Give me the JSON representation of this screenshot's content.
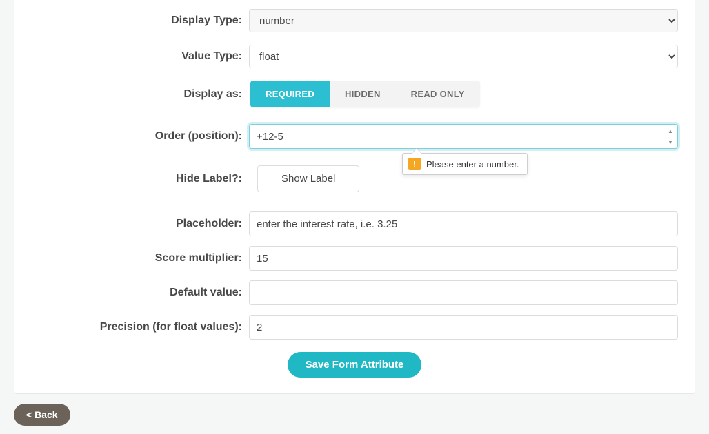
{
  "labels": {
    "display_type": "Display Type:",
    "value_type": "Value Type:",
    "display_as": "Display as:",
    "order": "Order (position):",
    "hide_label": "Hide Label?:",
    "placeholder": "Placeholder:",
    "score_multiplier": "Score multiplier:",
    "default_value": "Default value:",
    "precision": "Precision (for float values):"
  },
  "fields": {
    "display_type": "number",
    "value_type": "float",
    "order": "+12-5",
    "hide_label_button": "Show Label",
    "placeholder": "enter the interest rate, i.e. 3.25",
    "score_multiplier": "15",
    "default_value": "",
    "precision": "2"
  },
  "display_as_options": {
    "required": "REQUIRED",
    "hidden": "HIDDEN",
    "readonly": "READ ONLY"
  },
  "tooltip": "Please enter a number.",
  "buttons": {
    "save": "Save Form Attribute",
    "back": "< Back"
  }
}
